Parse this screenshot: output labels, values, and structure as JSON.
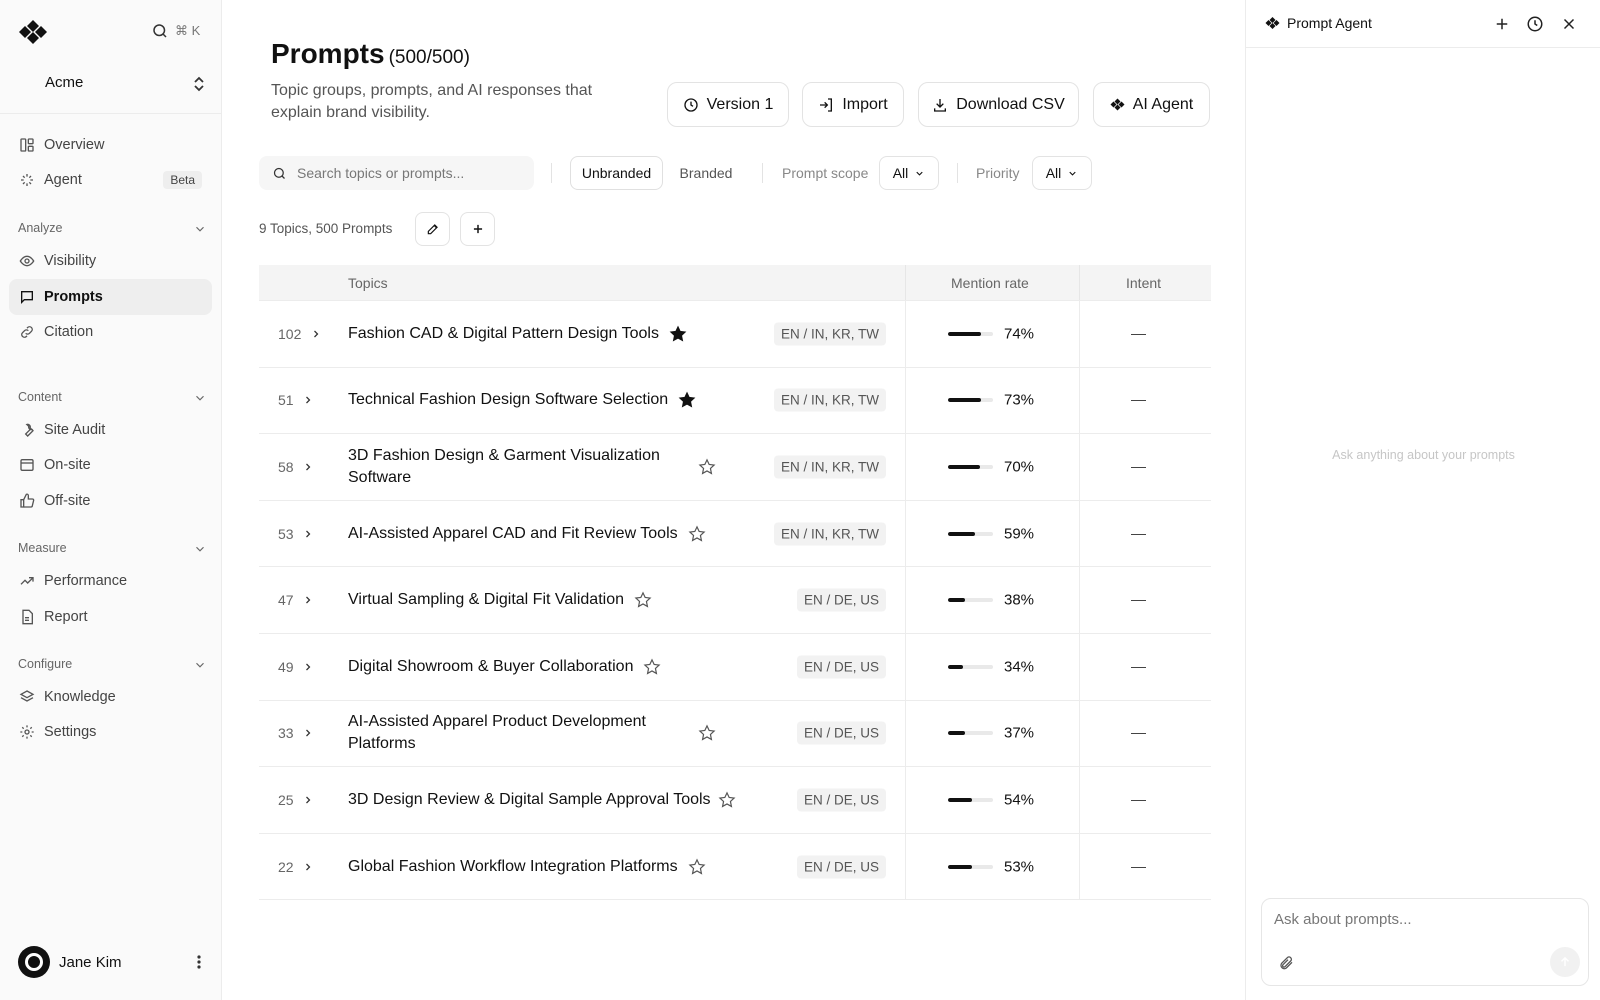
{
  "sidebar": {
    "shortcut": "⌘ K",
    "org_name": "Acme",
    "nav_top": [
      {
        "label": "Overview",
        "icon": "overview-icon"
      },
      {
        "label": "Agent",
        "icon": "sparkle-icon",
        "badge": "Beta"
      }
    ],
    "sections": [
      {
        "label": "Analyze",
        "items": [
          {
            "label": "Visibility",
            "icon": "eye-icon"
          },
          {
            "label": "Prompts",
            "icon": "message-icon",
            "active": true
          },
          {
            "label": "Citation",
            "icon": "link-icon"
          }
        ]
      },
      {
        "label": "Content",
        "items": [
          {
            "label": "Site Audit",
            "icon": "wrench-icon"
          },
          {
            "label": "On-site",
            "icon": "browser-icon"
          },
          {
            "label": "Off-site",
            "icon": "thumbs-up-icon"
          }
        ]
      },
      {
        "label": "Measure",
        "items": [
          {
            "label": "Performance",
            "icon": "trend-icon"
          },
          {
            "label": "Report",
            "icon": "report-icon"
          }
        ]
      },
      {
        "label": "Configure",
        "items": [
          {
            "label": "Knowledge",
            "icon": "layers-icon"
          },
          {
            "label": "Settings",
            "icon": "gear-icon"
          }
        ]
      }
    ],
    "user_name": "Jane Kim"
  },
  "page": {
    "title": "Prompts",
    "count": "(500/500)",
    "subtitle": "Topic groups, prompts, and AI responses that explain brand visibility.",
    "actions": {
      "version": "Version 1",
      "import": "Import",
      "download": "Download CSV",
      "ai_agent": "AI Agent"
    },
    "search_placeholder": "Search topics or prompts...",
    "segments": {
      "unbranded": "Unbranded",
      "branded": "Branded"
    },
    "filters": {
      "scope_label": "Prompt scope",
      "scope_value": "All",
      "priority_label": "Priority",
      "priority_value": "All"
    },
    "meta": "9 Topics, 500 Prompts"
  },
  "table": {
    "headers": {
      "topics": "Topics",
      "mention_rate": "Mention rate",
      "intent": "Intent"
    },
    "rows": [
      {
        "count": "102",
        "topic": "Fashion CAD & Digital Pattern Design Tools",
        "starred": true,
        "region": "EN / IN, KR, TW",
        "rate": 74,
        "rate_label": "74%",
        "intent": "—"
      },
      {
        "count": "51",
        "topic": "Technical Fashion Design Software Selection",
        "starred": true,
        "region": "EN / IN, KR, TW",
        "rate": 73,
        "rate_label": "73%",
        "intent": "—"
      },
      {
        "count": "58",
        "topic": "3D Fashion Design & Garment Visualization Software",
        "starred": false,
        "region": "EN / IN, KR, TW",
        "rate": 70,
        "rate_label": "70%",
        "intent": "—"
      },
      {
        "count": "53",
        "topic": "AI-Assisted Apparel CAD and Fit Review Tools",
        "starred": false,
        "region": "EN / IN, KR, TW",
        "rate": 59,
        "rate_label": "59%",
        "intent": "—"
      },
      {
        "count": "47",
        "topic": "Virtual Sampling & Digital Fit Validation",
        "starred": false,
        "region": "EN / DE, US",
        "rate": 38,
        "rate_label": "38%",
        "intent": "—"
      },
      {
        "count": "49",
        "topic": "Digital Showroom & Buyer Collaboration",
        "starred": false,
        "region": "EN / DE, US",
        "rate": 34,
        "rate_label": "34%",
        "intent": "—"
      },
      {
        "count": "33",
        "topic": "AI-Assisted Apparel Product Development Platforms",
        "starred": false,
        "region": "EN / DE, US",
        "rate": 37,
        "rate_label": "37%",
        "intent": "—"
      },
      {
        "count": "25",
        "topic": "3D Design Review & Digital Sample Approval Tools",
        "starred": false,
        "region": "EN / DE, US",
        "rate": 54,
        "rate_label": "54%",
        "intent": "—"
      },
      {
        "count": "22",
        "topic": "Global Fashion Workflow Integration Platforms",
        "starred": false,
        "region": "EN / DE, US",
        "rate": 53,
        "rate_label": "53%",
        "intent": "—"
      }
    ]
  },
  "agent": {
    "title": "Prompt Agent",
    "hint": "Ask anything about your prompts",
    "input_placeholder": "Ask about prompts..."
  },
  "colors": {
    "accent": "#111111",
    "active_nav_bg": "#eeeeee",
    "bar_track": "#e9e9e9"
  }
}
